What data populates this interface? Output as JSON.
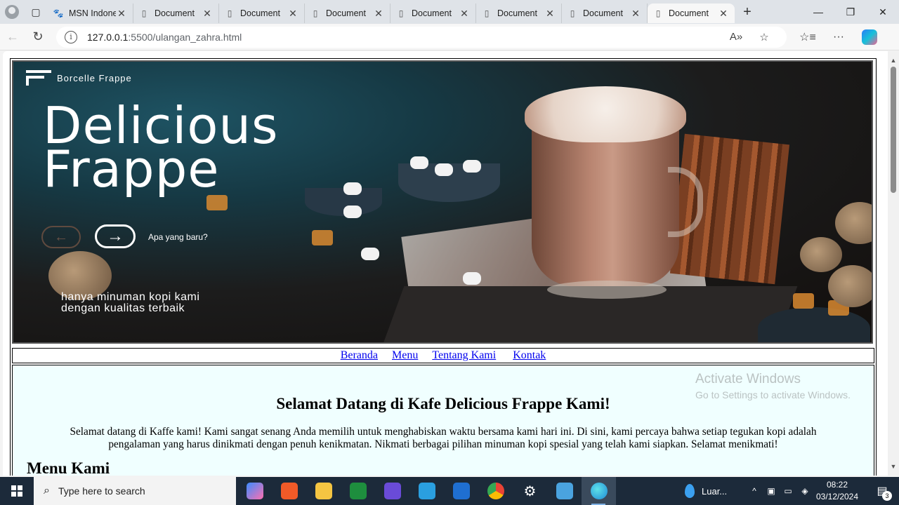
{
  "browser": {
    "tabs": [
      {
        "label": "MSN Indonesia",
        "icon": "msn-icon",
        "active": false
      },
      {
        "label": "Document",
        "icon": "document-icon",
        "active": false
      },
      {
        "label": "Document",
        "icon": "document-icon",
        "active": false
      },
      {
        "label": "Document",
        "icon": "document-icon",
        "active": false
      },
      {
        "label": "Document",
        "icon": "document-icon",
        "active": false
      },
      {
        "label": "Document",
        "icon": "document-icon",
        "active": false
      },
      {
        "label": "Document",
        "icon": "document-icon",
        "active": false
      },
      {
        "label": "Document",
        "icon": "document-icon",
        "active": true
      }
    ],
    "url_host": "127.0.0.1",
    "url_path": ":5500/ulangan_zahra.html"
  },
  "hero": {
    "brand": "Borcelle Frappe",
    "title_line1": "Delicious",
    "title_line2": "Frappe",
    "whats_new": "Apa yang baru?",
    "tagline_line1": "hanya minuman kopi kami",
    "tagline_line2": "dengan kualitas terbaik"
  },
  "nav": {
    "items": [
      "Beranda",
      "Menu",
      "Tentang Kami",
      "Kontak"
    ]
  },
  "content": {
    "heading": "Selamat Datang di Kafe Delicious Frappe Kami!",
    "paragraph": "Selamat datang di Kaffe kami! Kami sangat senang Anda memilih untuk menghabiskan waktu bersama kami hari ini. Di sini, kami percaya bahwa setiap tegukan kopi adalah pengalaman yang harus dinikmati dengan penuh kenikmatan. Nikmati berbagai pilihan minuman kopi spesial yang telah kami siapkan. Selamat menikmati!",
    "subheading": "Menu Kami"
  },
  "watermark": {
    "line1": "Activate Windows",
    "line2": "Go to Settings to activate Windows."
  },
  "taskbar": {
    "search_placeholder": "Type here to search",
    "weather": "Luar...",
    "time": "08:22",
    "date": "03/12/2024",
    "notifications": "3"
  },
  "colors": {
    "link": "#0000ee",
    "content_bg": "#f0ffff",
    "taskbar_bg": "#1c2a3a"
  }
}
